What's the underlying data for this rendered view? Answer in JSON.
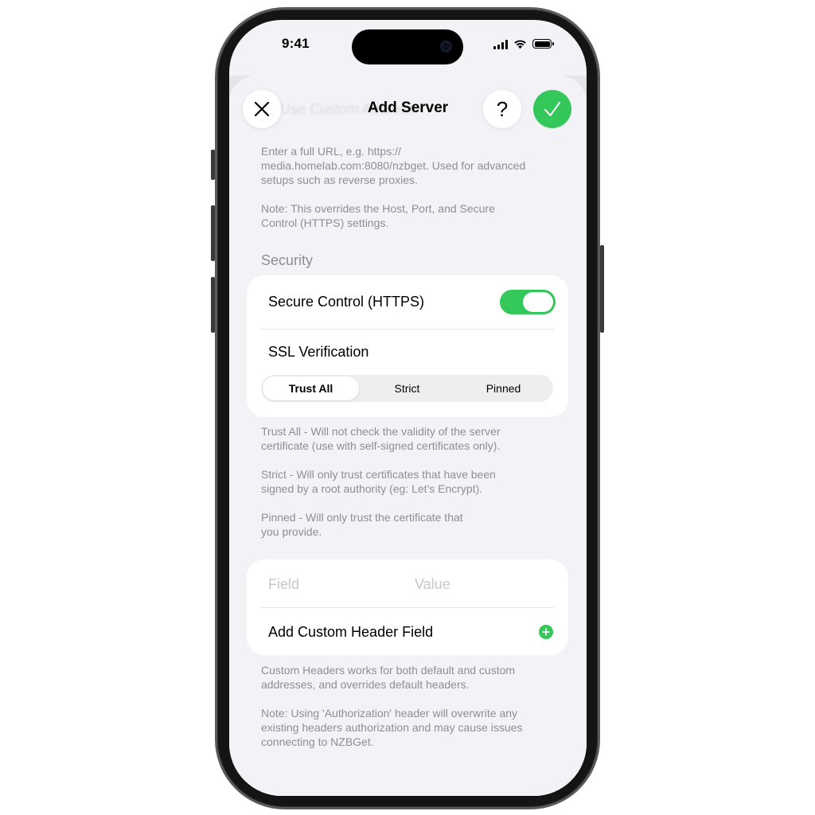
{
  "status_bar": {
    "time": "9:41"
  },
  "nav": {
    "title": "Add Server",
    "ghost_text": "Use Custom Address",
    "close_icon": "close-icon",
    "help_label": "?",
    "confirm_icon": "checkmark-icon"
  },
  "custom_address_footer": {
    "line1": "Enter a full URL, e.g. https://",
    "line2": "media.homelab.com:8080/nzbget. Used for advanced",
    "line3": "setups such as reverse proxies.",
    "note1": "Note: This overrides the Host, Port, and Secure",
    "note2": "Control (HTTPS) settings."
  },
  "security": {
    "header": "Security",
    "secure_control_label": "Secure Control (HTTPS)",
    "secure_control_on": true,
    "ssl_label": "SSL Verification",
    "ssl_options": [
      "Trust All",
      "Strict",
      "Pinned"
    ],
    "ssl_selected": "Trust All",
    "footer": {
      "trust1": "Trust All - Will not check the validity of the server",
      "trust2": "certificate (use with self-signed certificates only).",
      "strict1": "Strict - Will only trust certificates that have been",
      "strict2": "signed by a root authority (eg: Let's Encrypt).",
      "pinned1": "Pinned - Will only trust the certificate that",
      "pinned2": "you provide."
    }
  },
  "headers": {
    "field_placeholder": "Field",
    "value_placeholder": "Value",
    "add_label": "Add Custom Header Field",
    "footer": {
      "line1": "Custom Headers works for both default and custom",
      "line2": "addresses, and overrides default headers.",
      "note1": "Note: Using 'Authorization' header will overwrite any",
      "note2": "existing headers authorization and may cause issues",
      "note3": "connecting to NZBGet."
    }
  },
  "colors": {
    "accent": "#34c759",
    "background": "#f2f2f7",
    "secondary_text": "#8e8e93"
  }
}
